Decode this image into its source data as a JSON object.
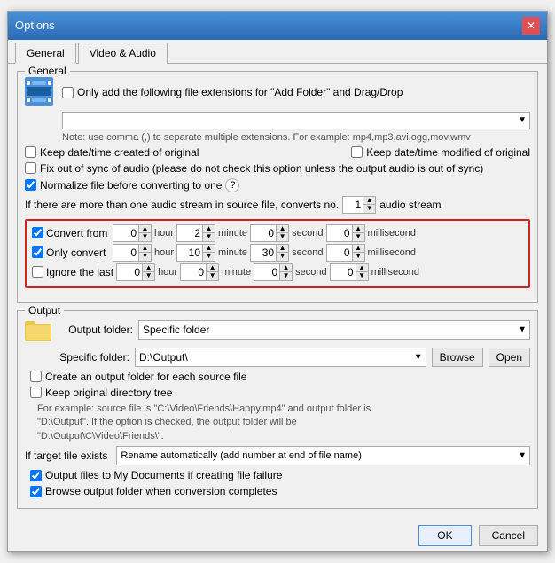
{
  "dialog": {
    "title": "Options",
    "close_label": "✕"
  },
  "tabs": {
    "general": "General",
    "video_audio": "Video & Audio"
  },
  "general_section": {
    "title": "General",
    "add_folder_checkbox": false,
    "add_folder_label": "Only add the following file extensions for \"Add Folder\" and Drag/Drop",
    "extensions_note": "Note: use comma (,) to separate multiple extensions. For example: mp4,mp3,avi,ogg,mov,wmv",
    "keep_date_created": false,
    "keep_date_created_label": "Keep date/time created of original",
    "keep_date_modified": false,
    "keep_date_modified_label": "Keep date/time modified of original",
    "fix_sync": false,
    "fix_sync_label": "Fix out of sync of audio (please do not check this option unless the output audio is out of sync)",
    "normalize": true,
    "normalize_label": "Normalize file before converting to one",
    "audio_stream_label": "If there are more than one audio stream in source file, converts no.",
    "audio_stream_value": "1",
    "audio_stream_suffix": "audio stream",
    "convert_from": {
      "checked": true,
      "label": "Convert from",
      "hour": "0",
      "minute": "2",
      "second": "0",
      "millisecond": "0"
    },
    "only_convert": {
      "checked": true,
      "label": "Only convert",
      "hour": "0",
      "minute": "10",
      "second": "30",
      "millisecond": "0"
    },
    "ignore_last": {
      "checked": false,
      "label": "Ignore the last",
      "hour": "0",
      "minute": "0",
      "second": "0",
      "millisecond": "0"
    },
    "units": {
      "hour": "hour",
      "minute": "minute",
      "second": "second",
      "millisecond": "millisecond"
    }
  },
  "output_section": {
    "title": "Output",
    "output_folder_label": "Output folder:",
    "output_folder_value": "Specific folder",
    "specific_folder_label": "Specific folder:",
    "specific_folder_value": "D:\\Output\\",
    "browse_label": "Browse",
    "open_label": "Open",
    "create_output_folder": false,
    "create_output_folder_label": "Create an output folder for each source file",
    "keep_directory": false,
    "keep_directory_label": "Keep original directory tree",
    "info_text": "For example: source file is \"C:\\Video\\Friends\\Happy.mp4\" and output folder is\n\"D:\\Output\". If the option is checked, the output folder will be\n\"D:\\Output\\C\\Video\\Friends\\\".",
    "target_exists_label": "If target file exists",
    "target_exists_value": "Rename automatically (add number at end of file name)",
    "output_my_docs": true,
    "output_my_docs_label": "Output files to My Documents if creating file failure",
    "browse_when_done": true,
    "browse_when_done_label": "Browse output folder when conversion completes"
  },
  "buttons": {
    "ok": "OK",
    "cancel": "Cancel"
  }
}
